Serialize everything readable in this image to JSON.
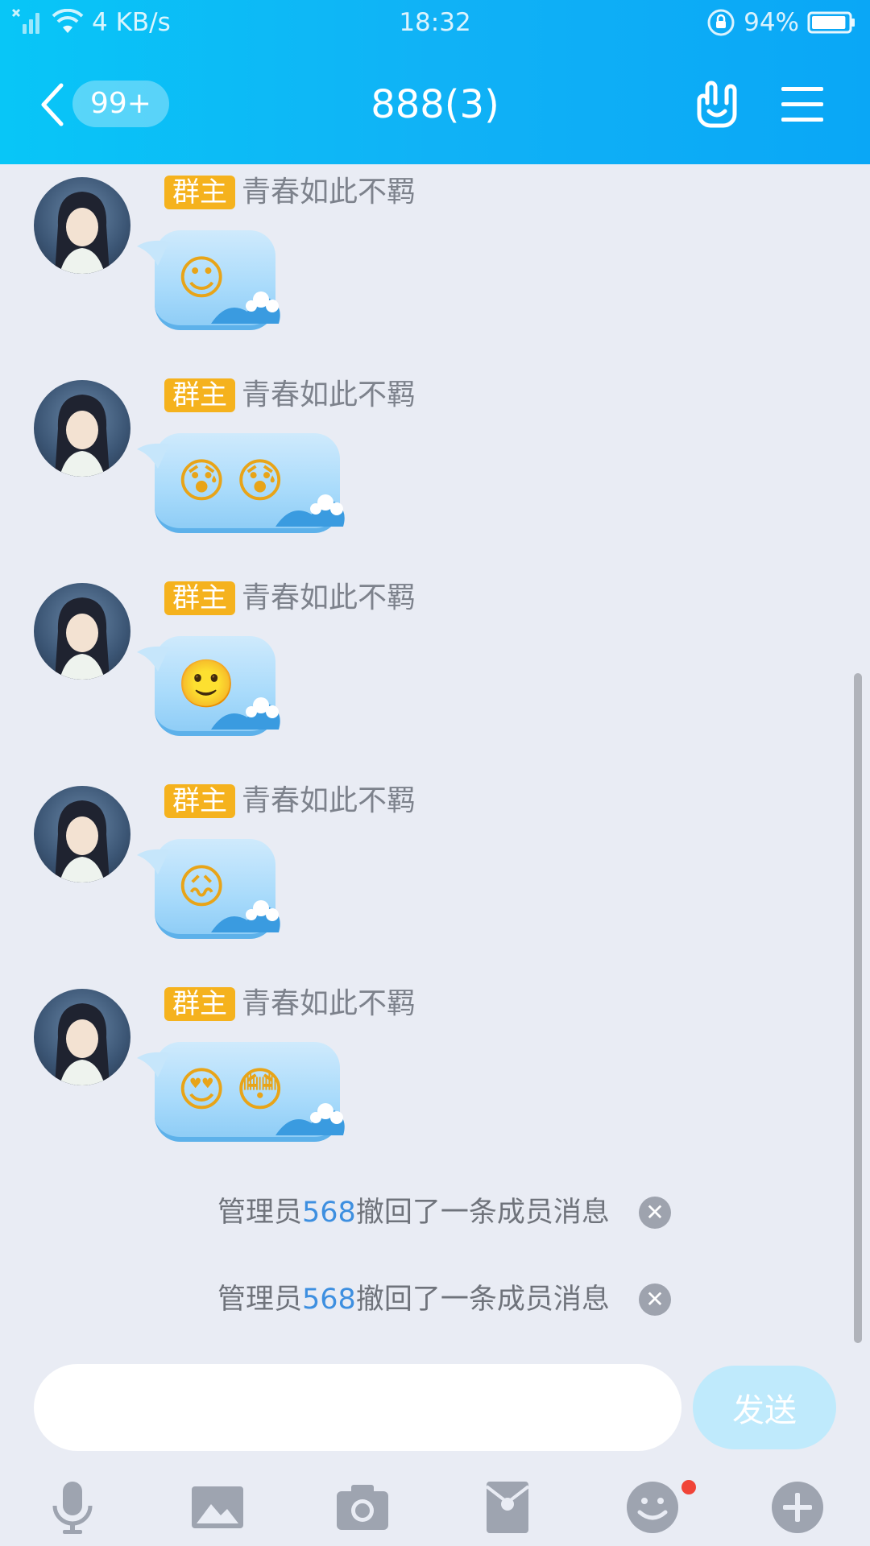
{
  "status_bar": {
    "net_speed": "4 KB/s",
    "time": "18:32",
    "battery": "94%",
    "battery_level": 0.94
  },
  "nav": {
    "unread": "99+",
    "title": "888(3)"
  },
  "messages": [
    {
      "role": "群主",
      "sender": "青春如此不羁",
      "emojis": [
        "☺"
      ]
    },
    {
      "role": "群主",
      "sender": "青春如此不羁",
      "emojis": [
        "😰",
        "😰"
      ]
    },
    {
      "role": "群主",
      "sender": "青春如此不羁",
      "emojis": [
        "🙂"
      ]
    },
    {
      "role": "群主",
      "sender": "青春如此不羁",
      "emojis": [
        "😖"
      ]
    },
    {
      "role": "群主",
      "sender": "青春如此不羁",
      "emojis": [
        "😍",
        "😳"
      ]
    }
  ],
  "notices": [
    {
      "prefix": "管理员",
      "highlight": "568",
      "suffix": "撤回了一条成员消息"
    },
    {
      "prefix": "管理员",
      "highlight": "568",
      "suffix": "撤回了一条成员消息"
    }
  ],
  "input": {
    "value": "",
    "send_label": "发送"
  },
  "toolbar_icons": [
    "microphone-icon",
    "image-icon",
    "camera-icon",
    "red-packet-icon",
    "emoji-icon",
    "plus-icon"
  ],
  "colors": {
    "header": "#10b2f6",
    "role_badge": "#f5b21d",
    "highlight": "#3d8fe0",
    "send_disabled": "#bfeafc"
  }
}
